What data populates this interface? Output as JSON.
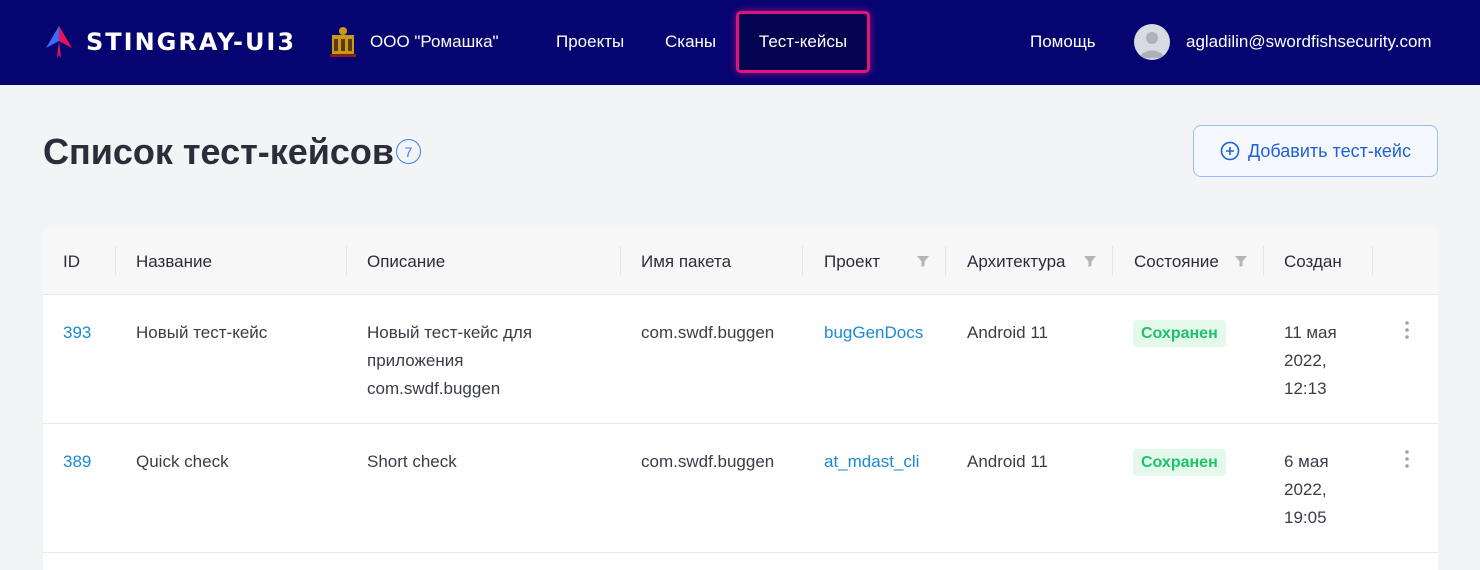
{
  "header": {
    "logo_text": "STINGRAY-UI3",
    "org_name": "ООО \"Ромашка\"",
    "nav": [
      "Проекты",
      "Сканы",
      "Тест-кейсы"
    ],
    "active_nav": "Тест-кейсы",
    "help": "Помощь",
    "user_email": "agladilin@swordfishsecurity.com"
  },
  "page": {
    "title": "Список тест-кейсов",
    "count": "7",
    "add_button": "Добавить тест-кейс"
  },
  "table": {
    "columns": [
      "ID",
      "Название",
      "Описание",
      "Имя пакета",
      "Проект",
      "Архитектура",
      "Состояние",
      "Создан"
    ],
    "rows": [
      {
        "id": "393",
        "name": "Новый тест-кейс",
        "desc": [
          "Новый тест-кейс для",
          "приложения",
          "com.swdf.buggen"
        ],
        "package": "com.swdf.buggen",
        "project": "bugGenDocs",
        "arch": "Android 11",
        "status": "Сохранен",
        "created": [
          "11 мая",
          "2022,",
          "12:13"
        ]
      },
      {
        "id": "389",
        "name": "Quick check",
        "desc": [
          "Short check"
        ],
        "package": "com.swdf.buggen",
        "project": "at_mdast_cli",
        "arch": "Android 11",
        "status": "Сохранен",
        "created": [
          "6 мая",
          "2022,",
          "19:05"
        ]
      }
    ]
  },
  "colors": {
    "header_bg": "#050470",
    "active_border": "#e0147f",
    "link": "#1a8ad4",
    "status_text": "#1ec26a",
    "status_bg": "#e5f8ec"
  }
}
